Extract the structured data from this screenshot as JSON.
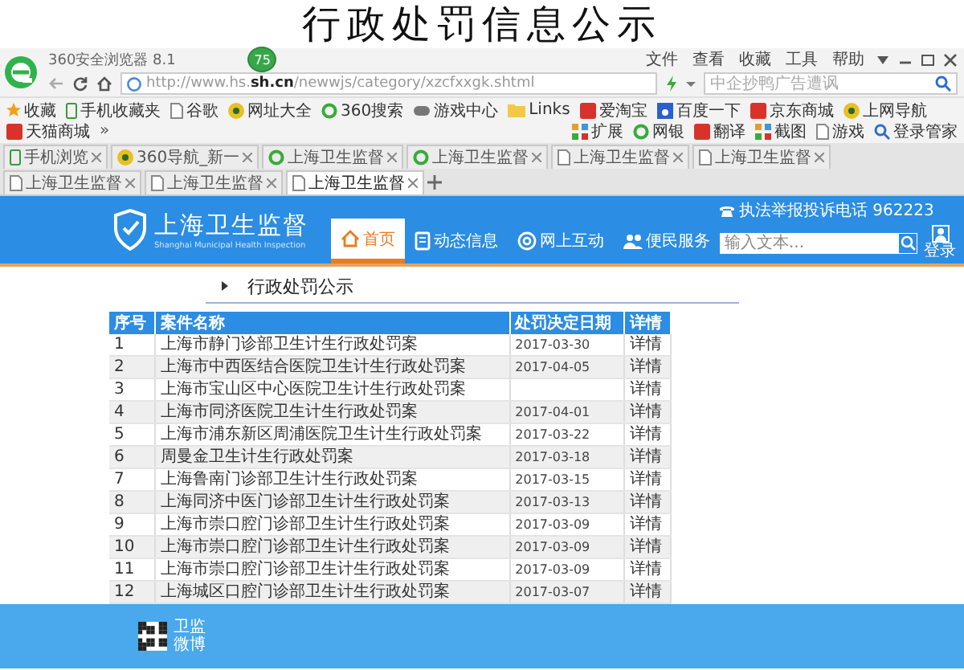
{
  "page_title": "行政处罚信息公示",
  "browser": {
    "title": "360安全浏览器 8.1",
    "badge": "75",
    "menu": [
      "文件",
      "查看",
      "收藏",
      "工具",
      "帮助"
    ],
    "address": {
      "url": "http://www.hs.**sh.cn**/newwjs/category/xzcfxxgk.shtml"
    },
    "search": {
      "placeholder": "中企抄鸭广告遭讽"
    },
    "bookmarks": [
      {
        "label": "收藏",
        "kind": "star"
      },
      {
        "label": "手机收藏夹",
        "kind": "phone"
      },
      {
        "label": "谷歌",
        "kind": "page"
      },
      {
        "label": "网址大全",
        "kind": "badge"
      },
      {
        "label": "360搜索",
        "kind": "ring"
      },
      {
        "label": "游戏中心",
        "kind": "game"
      },
      {
        "label": "Links",
        "kind": "folder"
      },
      {
        "label": "爱淘宝",
        "kind": "square"
      },
      {
        "label": "百度一下",
        "kind": "paw"
      },
      {
        "label": "京东商城",
        "kind": "square"
      },
      {
        "label": "上网导航",
        "kind": "badge"
      },
      {
        "label": "天猫商城",
        "kind": "square"
      }
    ],
    "bookmarks_more": "»",
    "tools": [
      {
        "label": "扩展",
        "kind": "grid"
      },
      {
        "label": "网银",
        "kind": "ring"
      },
      {
        "label": "翻译",
        "kind": "square"
      },
      {
        "label": "截图",
        "kind": "grid"
      },
      {
        "label": "游戏",
        "kind": "page"
      },
      {
        "label": "登录管家",
        "kind": "search"
      }
    ],
    "tabs": [
      {
        "label": "手机浏览",
        "kind": "phone",
        "selected": false
      },
      {
        "label": "360导航_新一",
        "kind": "badge",
        "selected": false
      },
      {
        "label": "上海卫生监督",
        "kind": "ring",
        "selected": false
      },
      {
        "label": "上海卫生监督",
        "kind": "ring",
        "selected": false
      },
      {
        "label": "上海卫生监督",
        "kind": "page",
        "selected": false
      },
      {
        "label": "上海卫生监督",
        "kind": "page",
        "selected": false
      },
      {
        "label": "上海卫生监督",
        "kind": "page",
        "selected": false
      },
      {
        "label": "上海卫生监督",
        "kind": "page",
        "selected": false
      },
      {
        "label": "上海卫生监督",
        "kind": "page",
        "selected": true
      }
    ]
  },
  "site": {
    "logo_title": "上海卫生监督",
    "logo_subtitle": "Shanghai Municipal Health Inspection",
    "nav": [
      {
        "label": "首页",
        "kind": "home",
        "selected": true
      },
      {
        "label": "动态信息",
        "kind": "doc",
        "selected": false
      },
      {
        "label": "网上互动",
        "kind": "at",
        "selected": false
      },
      {
        "label": "便民服务",
        "kind": "people",
        "selected": false
      }
    ],
    "hotline": "执法举报投诉电话 962223",
    "search": {
      "placeholder": "输入文本..."
    },
    "login": "登录"
  },
  "breadcrumb": "行政处罚公示",
  "table": {
    "columns": [
      "序号",
      "案件名称",
      "处罚决定日期",
      "详情"
    ],
    "rows": [
      {
        "no": "1",
        "name": "上海市静门诊部卫生计生行政处罚案",
        "date": "2017-03-30",
        "detail": "详情"
      },
      {
        "no": "2",
        "name": "上海市中西医结合医院卫生计生行政处罚案",
        "date": "2017-04-05",
        "detail": "详情"
      },
      {
        "no": "3",
        "name": "上海市宝山区中心医院卫生计生行政处罚案",
        "detail": "详情"
      },
      {
        "no": "4",
        "name": "上海市同济医院卫生计生行政处罚案",
        "date": "2017-04-01",
        "detail": "详情"
      },
      {
        "no": "5",
        "name": "上海市浦东新区周浦医院卫生计生行政处罚案",
        "date": "2017-03-22",
        "detail": "详情"
      },
      {
        "no": "6",
        "name": "周曼金卫生计生行政处罚案",
        "date": "2017-03-18",
        "detail": "详情"
      },
      {
        "no": "7",
        "name": "上海鲁南门诊部卫生计生行政处罚案",
        "date": "2017-03-15",
        "detail": "详情"
      },
      {
        "no": "8",
        "name": "上海同济中医门诊部卫生计生行政处罚案",
        "date": "2017-03-13",
        "detail": "详情"
      },
      {
        "no": "9",
        "name": "上海市崇口腔门诊部卫生计生行政处罚案",
        "date": "2017-03-09",
        "detail": "详情"
      },
      {
        "no": "10",
        "name": "上海市崇口腔门诊部卫生计生行政处罚案",
        "date": "2017-03-09",
        "detail": "详情"
      },
      {
        "no": "11",
        "name": "上海市崇口腔门诊部卫生计生行政处罚案",
        "date": "2017-03-09",
        "detail": "详情"
      },
      {
        "no": "12",
        "name": "上海城区口腔门诊部卫生计生行政处罚案",
        "date": "2017-03-07",
        "detail": "详情"
      }
    ]
  },
  "footer": {
    "lines": [
      "卫监",
      "微博"
    ]
  }
}
